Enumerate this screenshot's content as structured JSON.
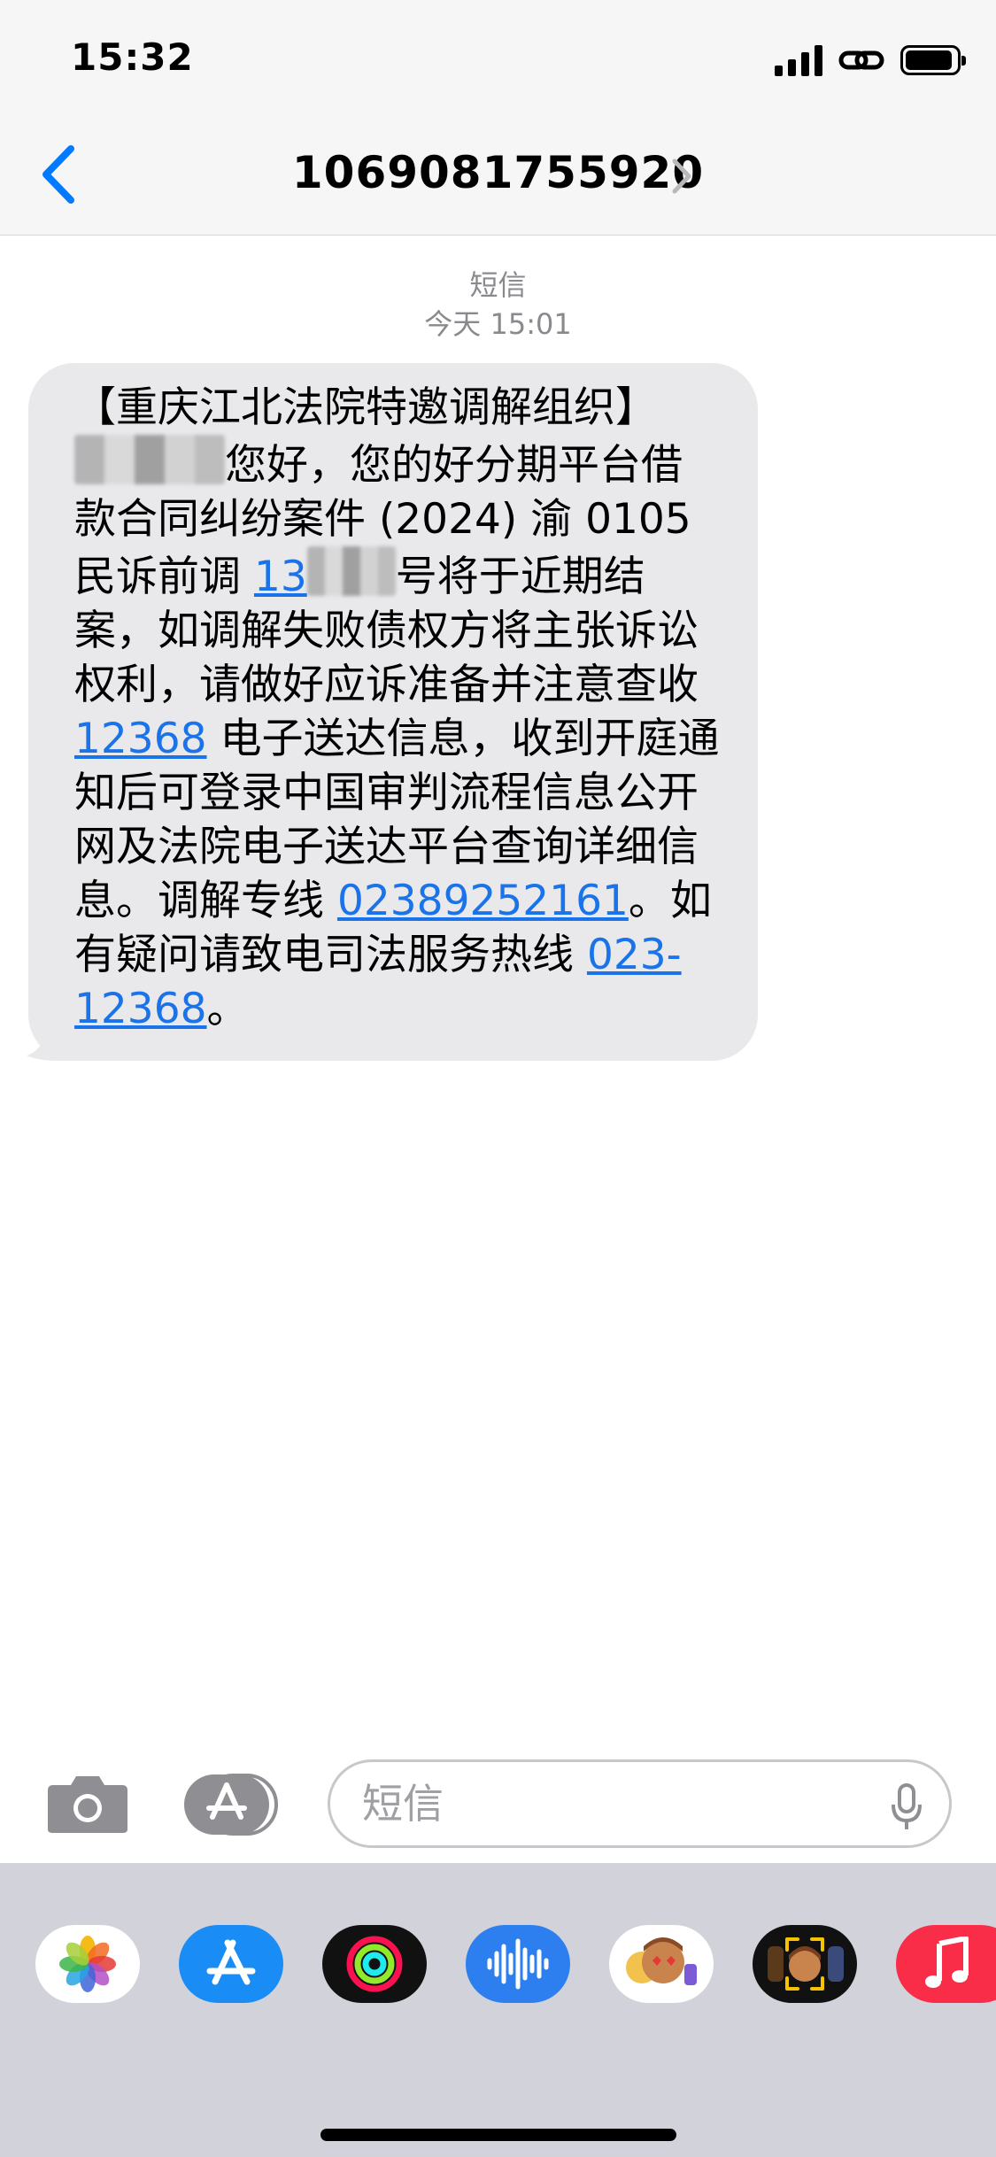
{
  "status_bar": {
    "time": "15:32"
  },
  "nav": {
    "contact": "1069081755920"
  },
  "thread": {
    "service_label": "短信",
    "timestamp": "今天 15:01"
  },
  "message": {
    "p1": "【重庆江北法院特邀调解组织】",
    "p2": "您好，您的好分期平台借款合同纠纷案件 (2024) 渝 0105 民诉前调 ",
    "case_prefix": "13",
    "p3": "号将于近期结案，如调解失败债权方将主张诉讼权利，请做好应诉准备并注意查收 ",
    "link_12368": "12368",
    "p4": " 电子送达信息，收到开庭通知后可登录中国审判流程信息公开网及法院电子送达平台查询详细信息。调解专线 ",
    "phone1": "02389252161",
    "p5": "。如有疑问请致电司法服务热线 ",
    "phone2": "023-12368",
    "p6": "。"
  },
  "compose": {
    "placeholder": "短信"
  },
  "drawer_apps": [
    "photos-app",
    "app-store-app",
    "activity-app",
    "audio-app",
    "memoji-stickers-app",
    "memoji-app",
    "music-app"
  ],
  "colors": {
    "accent": "#1a73e8",
    "bubble": "#e9e9eb",
    "ios_blue": "#007aff"
  }
}
